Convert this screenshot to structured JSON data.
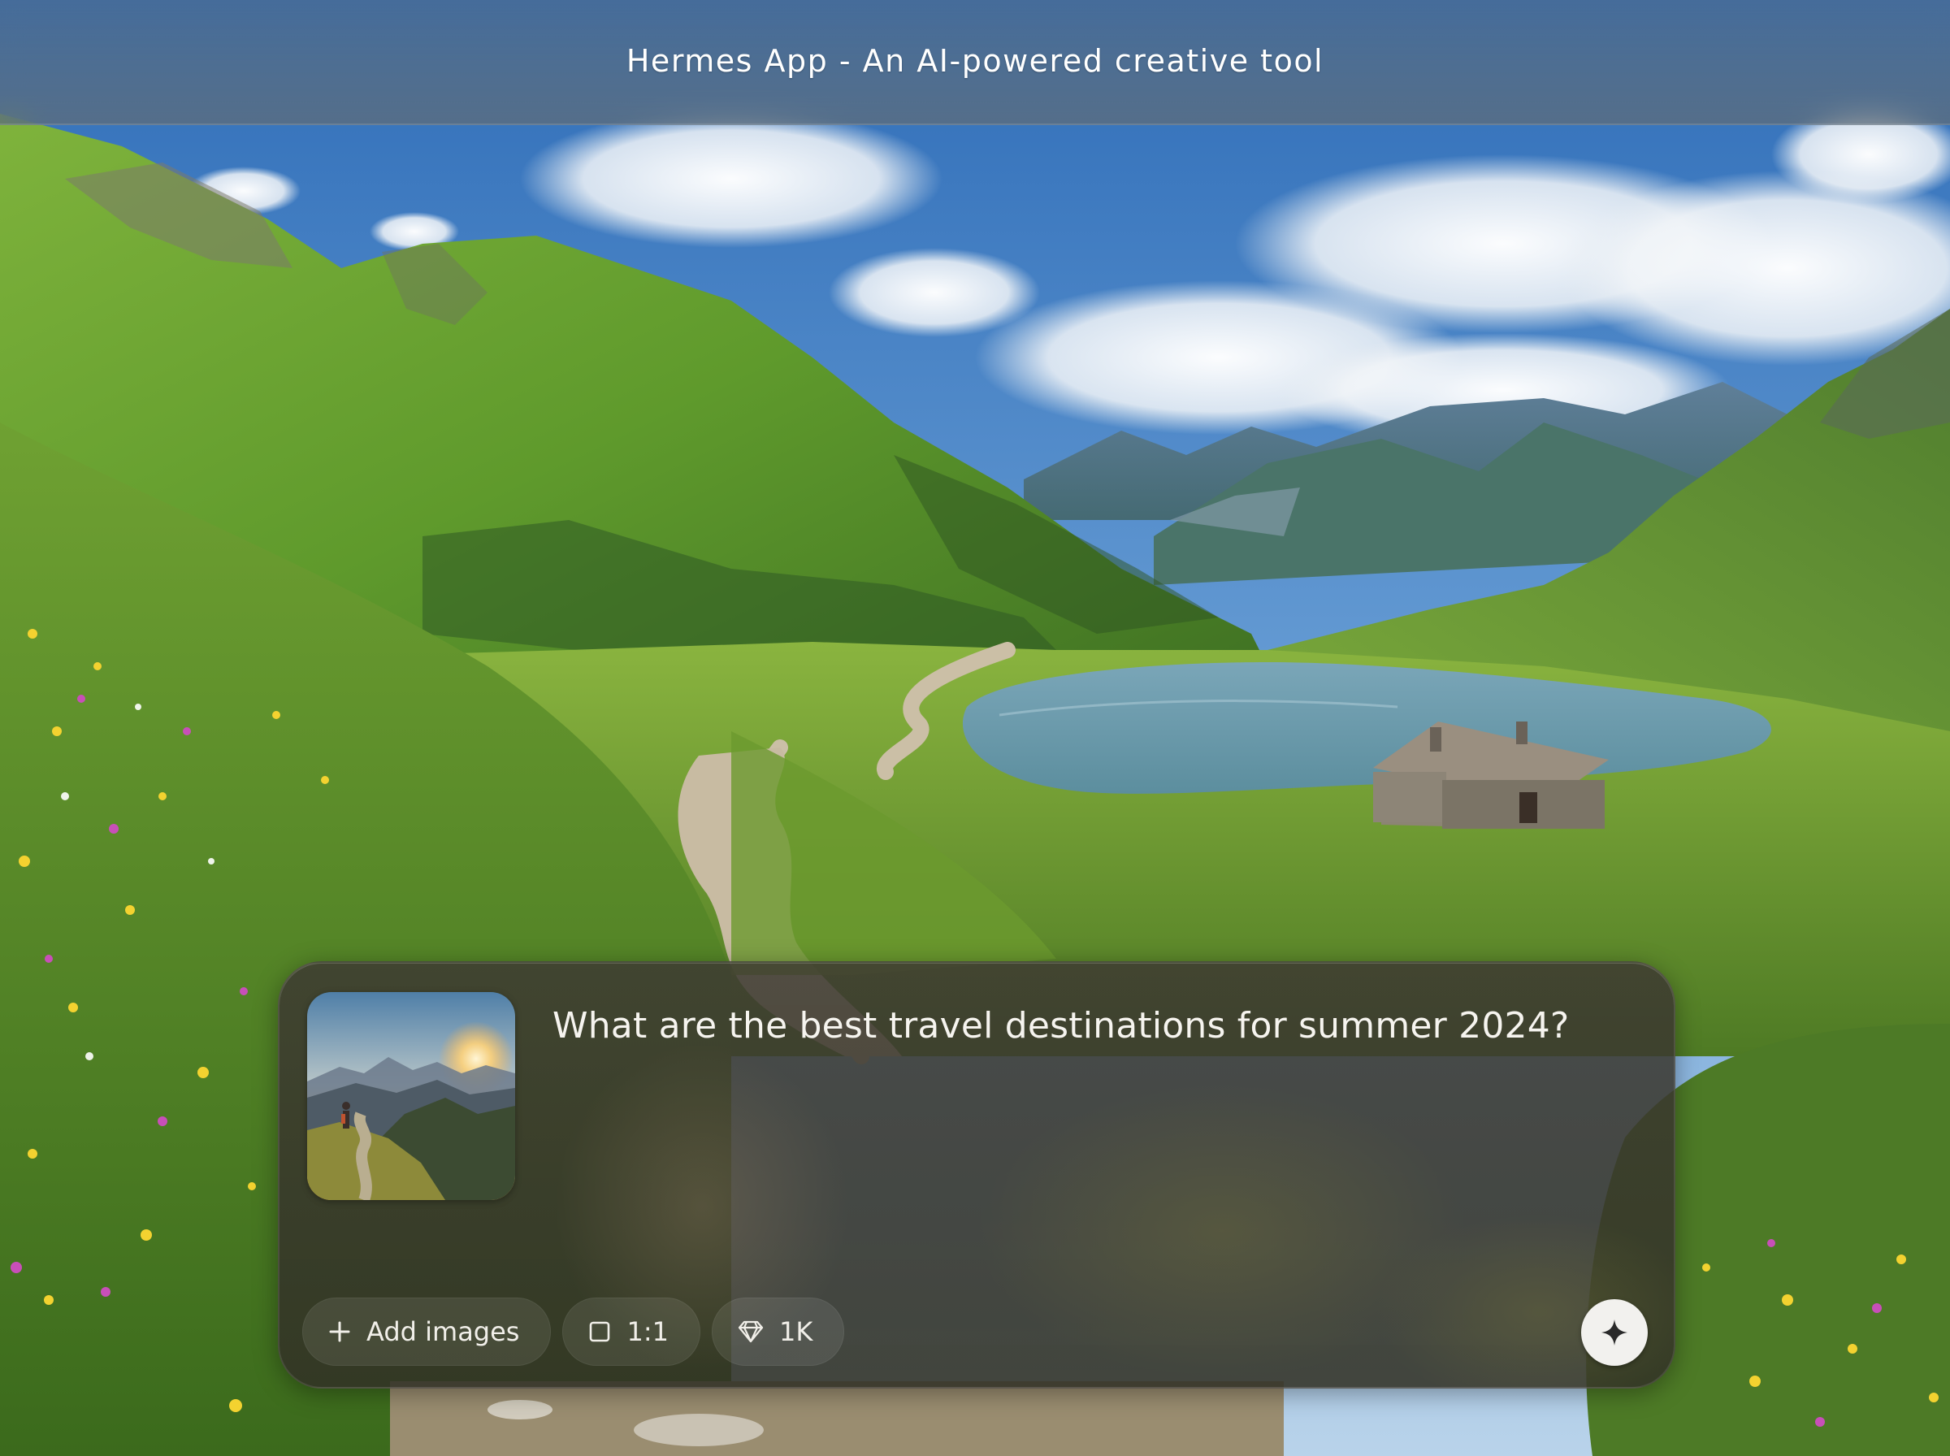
{
  "window": {
    "title": "Hermes App - An AI-powered creative tool"
  },
  "composer": {
    "prompt": "What are the best travel destinations for summer 2024?",
    "attachment": {
      "kind": "image-thumbnail",
      "subject": "hiker on mountain trail at sunset"
    },
    "toolbar": {
      "add_images_label": "Add images",
      "add_images_icon": "plus-icon",
      "aspect_ratio_label": "1:1",
      "aspect_ratio_icon": "square-icon",
      "resolution_label": "1K",
      "resolution_icon": "diamond-icon"
    },
    "generate_icon": "sparkle-icon"
  },
  "colors": {
    "composer_bg": "#3e3a32",
    "text": "#f6f4ef",
    "generate_button": "#f2f1ee",
    "generate_glyph": "#2a2a2a"
  }
}
